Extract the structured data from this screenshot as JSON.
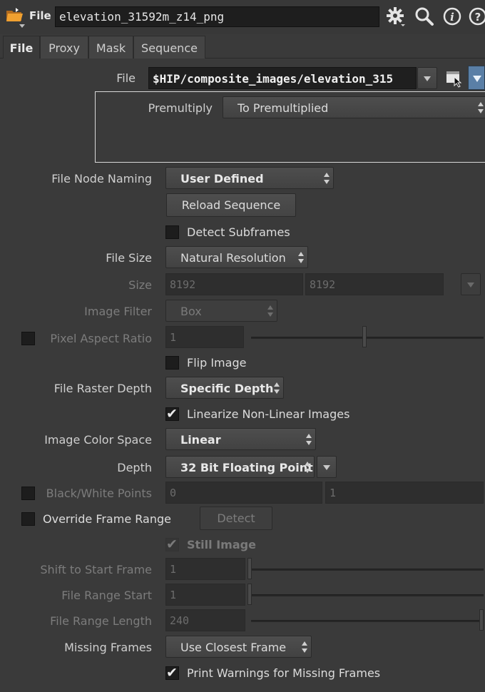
{
  "header": {
    "node_type": "File",
    "node_name": "elevation_31592m_z14_png",
    "icons": [
      "folder-icon",
      "gear-icon",
      "search-icon",
      "info-icon",
      "help-icon"
    ]
  },
  "tabs": [
    {
      "label": "File",
      "active": true
    },
    {
      "label": "Proxy"
    },
    {
      "label": "Mask"
    },
    {
      "label": "Sequence"
    }
  ],
  "file": {
    "label": "File",
    "value": "$HIP/composite_images/elevation_315"
  },
  "premultiply": {
    "label": "Premultiply",
    "value": "To Premultiplied"
  },
  "file_node_naming": {
    "label": "File Node Naming",
    "value": "User Defined"
  },
  "reload_sequence": "Reload Sequence",
  "detect_subframes": {
    "label": "Detect Subframes",
    "checked": false
  },
  "file_size": {
    "label": "File Size",
    "value": "Natural Resolution"
  },
  "size": {
    "label": "Size",
    "width": "8192",
    "height": "8192"
  },
  "image_filter": {
    "label": "Image Filter",
    "value": "Box"
  },
  "pixel_aspect_ratio": {
    "label": "Pixel Aspect Ratio",
    "value": "1",
    "enabled": false
  },
  "flip_image": {
    "label": "Flip Image",
    "checked": false
  },
  "file_raster_depth": {
    "label": "File Raster Depth",
    "value": "Specific Depth"
  },
  "linearize": {
    "label": "Linearize Non-Linear Images",
    "checked": true
  },
  "image_color_space": {
    "label": "Image Color Space",
    "value": "Linear"
  },
  "depth": {
    "label": "Depth",
    "value": "32 Bit Floating Point"
  },
  "black_white_points": {
    "label": "Black/White Points",
    "black": "0",
    "white": "1",
    "enabled": false
  },
  "override_frame_range": {
    "label": "Override Frame Range",
    "checked": false
  },
  "detect_button": "Detect",
  "still_image": {
    "label": "Still Image",
    "checked": true,
    "enabled": false
  },
  "shift_to_start_frame": {
    "label": "Shift to Start Frame",
    "value": "1"
  },
  "file_range_start": {
    "label": "File Range Start",
    "value": "1"
  },
  "file_range_length": {
    "label": "File Range Length",
    "value": "240"
  },
  "missing_frames": {
    "label": "Missing Frames",
    "value": "Use Closest Frame"
  },
  "print_warnings": {
    "label": "Print Warnings for Missing Frames",
    "checked": true
  }
}
